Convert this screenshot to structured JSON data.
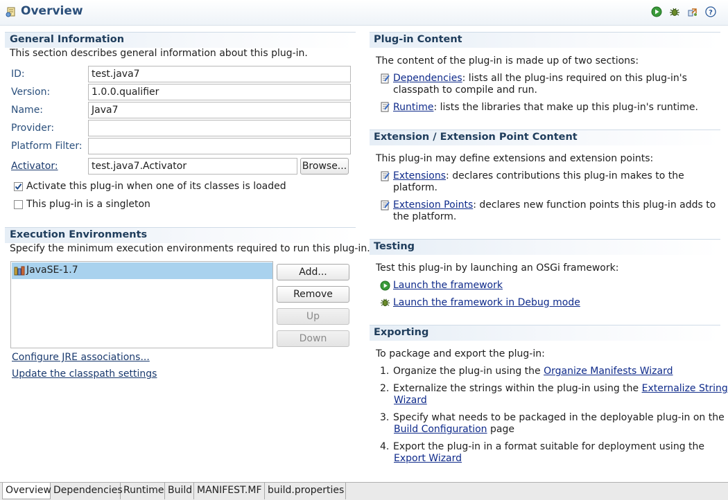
{
  "header": {
    "title": "Overview",
    "icons": [
      "run-icon",
      "debug-icon",
      "export-icon",
      "help-icon"
    ]
  },
  "general": {
    "title": "General Information",
    "description": "This section describes general information about this plug-in.",
    "id_label": "ID:",
    "id_value": "test.java7",
    "version_label": "Version:",
    "version_value": "1.0.0.qualifier",
    "name_label": "Name:",
    "name_value": "Java7",
    "provider_label": "Provider:",
    "provider_value": "",
    "platform_filter_label": "Platform Filter:",
    "platform_filter_value": "",
    "activator_label": "Activator:",
    "activator_value": "test.java7.Activator",
    "browse_label": "Browse...",
    "activate_checkbox_label": "Activate this plug-in when one of its classes is loaded",
    "activate_checked": true,
    "singleton_checkbox_label": "This plug-in is a singleton",
    "singleton_checked": false
  },
  "execution": {
    "title": "Execution Environments",
    "description": "Specify the minimum execution environments required to run this plug-in.",
    "environments": [
      "JavaSE-1.7"
    ],
    "add_label": "Add...",
    "remove_label": "Remove",
    "up_label": "Up",
    "down_label": "Down",
    "configure_jre_link": "Configure JRE associations...",
    "update_classpath_link": "Update the classpath settings"
  },
  "plugin_content": {
    "title": "Plug-in Content",
    "intro": "The content of the plug-in is made up of two sections:",
    "dependencies_link": "Dependencies",
    "dependencies_text_1": ": lists all the plug-ins required on this plug-in's",
    "dependencies_text_2": "classpath to compile and run.",
    "runtime_link": "Runtime",
    "runtime_text": ": lists the libraries that make up this plug-in's runtime."
  },
  "extension_content": {
    "title": "Extension / Extension Point Content",
    "intro": "This plug-in may define extensions and extension points:",
    "extensions_link": "Extensions",
    "extensions_text_1": ": declares contributions this plug-in makes to the",
    "extensions_text_2": "platform.",
    "extension_points_link": "Extension Points",
    "extension_points_text_1": ": declares new function points this plug-in adds to",
    "extension_points_text_2": "the platform."
  },
  "testing": {
    "title": "Testing",
    "intro": "Test this plug-in by launching an OSGi framework:",
    "launch_link": "Launch the framework",
    "debug_link": "Launch the framework in Debug mode"
  },
  "exporting": {
    "title": "Exporting",
    "intro": "To package and export the plug-in:",
    "n1": "1.",
    "step1_text": "Organize the plug-in using the ",
    "step1_link": "Organize Manifests Wizard",
    "n2": "2.",
    "step2_text": "Externalize the strings within the plug-in using the ",
    "step2_link_1": "Externalize Strings",
    "step2_link_2": "Wizard",
    "n3": "3.",
    "step3_text": "Specify what needs to be packaged in the deployable plug-in on the",
    "step3_link": "Build Configuration",
    "step3_suffix": " page",
    "n4": "4.",
    "step4_text": "Export the plug-in in a format suitable for deployment using the",
    "step4_link": "Export Wizard"
  },
  "tabs": [
    "Overview",
    "Dependencies",
    "Runtime",
    "Build",
    "MANIFEST.MF",
    "build.properties"
  ],
  "active_tab": "Overview"
}
